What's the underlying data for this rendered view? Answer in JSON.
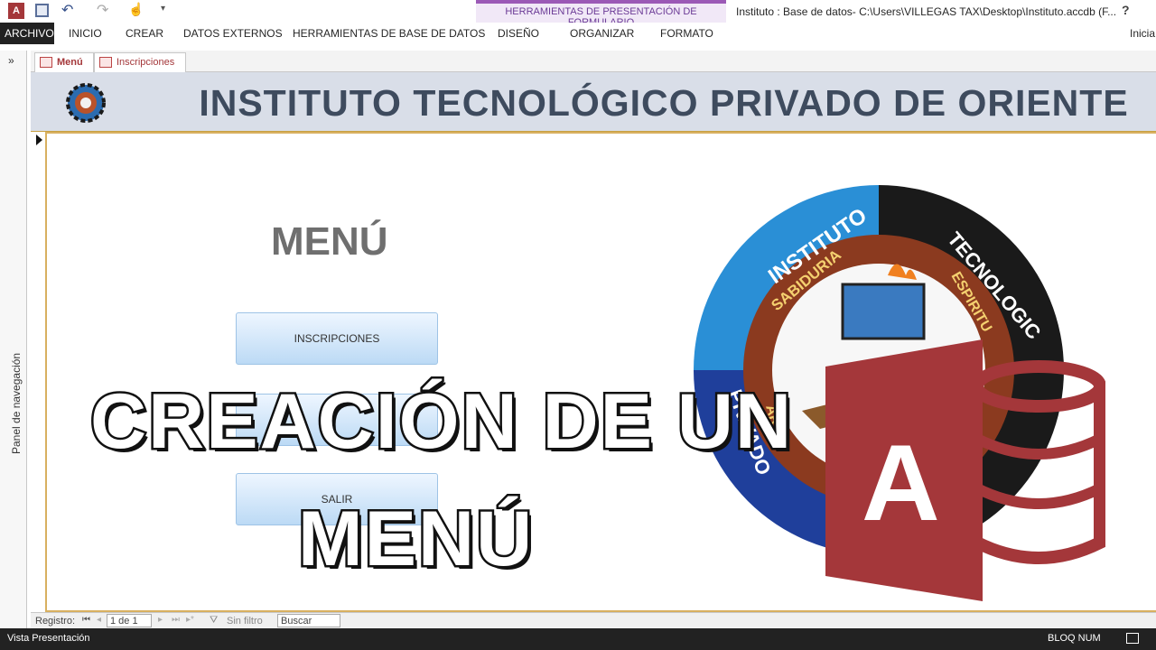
{
  "window": {
    "title": "Instituto : Base de datos- C:\\Users\\VILLEGAS TAX\\Desktop\\Instituto.accdb (F...",
    "help": "?"
  },
  "ribbon": {
    "file_tab": "ARCHIVO",
    "tabs": [
      "INICIO",
      "CREAR",
      "DATOS EXTERNOS",
      "HERRAMIENTAS DE BASE DE DATOS"
    ],
    "context_group": "HERRAMIENTAS DE PRESENTACIÓN DE FORMULARIO",
    "context_tabs": [
      "DISEÑO",
      "ORGANIZAR",
      "FORMATO"
    ],
    "signin": "Inicia"
  },
  "navpane": {
    "label": "Panel de navegación",
    "toggle": "»"
  },
  "doc_tabs": [
    "Menú",
    "Inscripciones"
  ],
  "form": {
    "header_title": "INSTITUTO TECNOLÓGICO PRIVADO DE ORIENTE",
    "menu_title": "MENÚ",
    "buttons": [
      "INSCRIPCIONES",
      "",
      "SALIR"
    ],
    "logo_text": {
      "ring_top": "INSTITUTO",
      "ring_right": "TECNOLOGIC",
      "ring_left": "PRIVADO",
      "inner_top": "SABIDURIA",
      "inner_right": "ESPIRITU",
      "inner_left": "ARTE"
    }
  },
  "overlay": {
    "line1": "CREACIÓN DE UN",
    "line2": "MENÚ"
  },
  "access_logo": {
    "letter": "A"
  },
  "record_nav": {
    "label": "Registro:",
    "current": "1 de 1",
    "filter": "Sin filtro",
    "search": "Buscar"
  },
  "status": {
    "left": "Vista Presentación",
    "bloq": "BLOQ NUM"
  },
  "colors": {
    "access_red": "#a4373a",
    "ctx_purple": "#9b59b6",
    "header_bg": "#d9dee8"
  }
}
